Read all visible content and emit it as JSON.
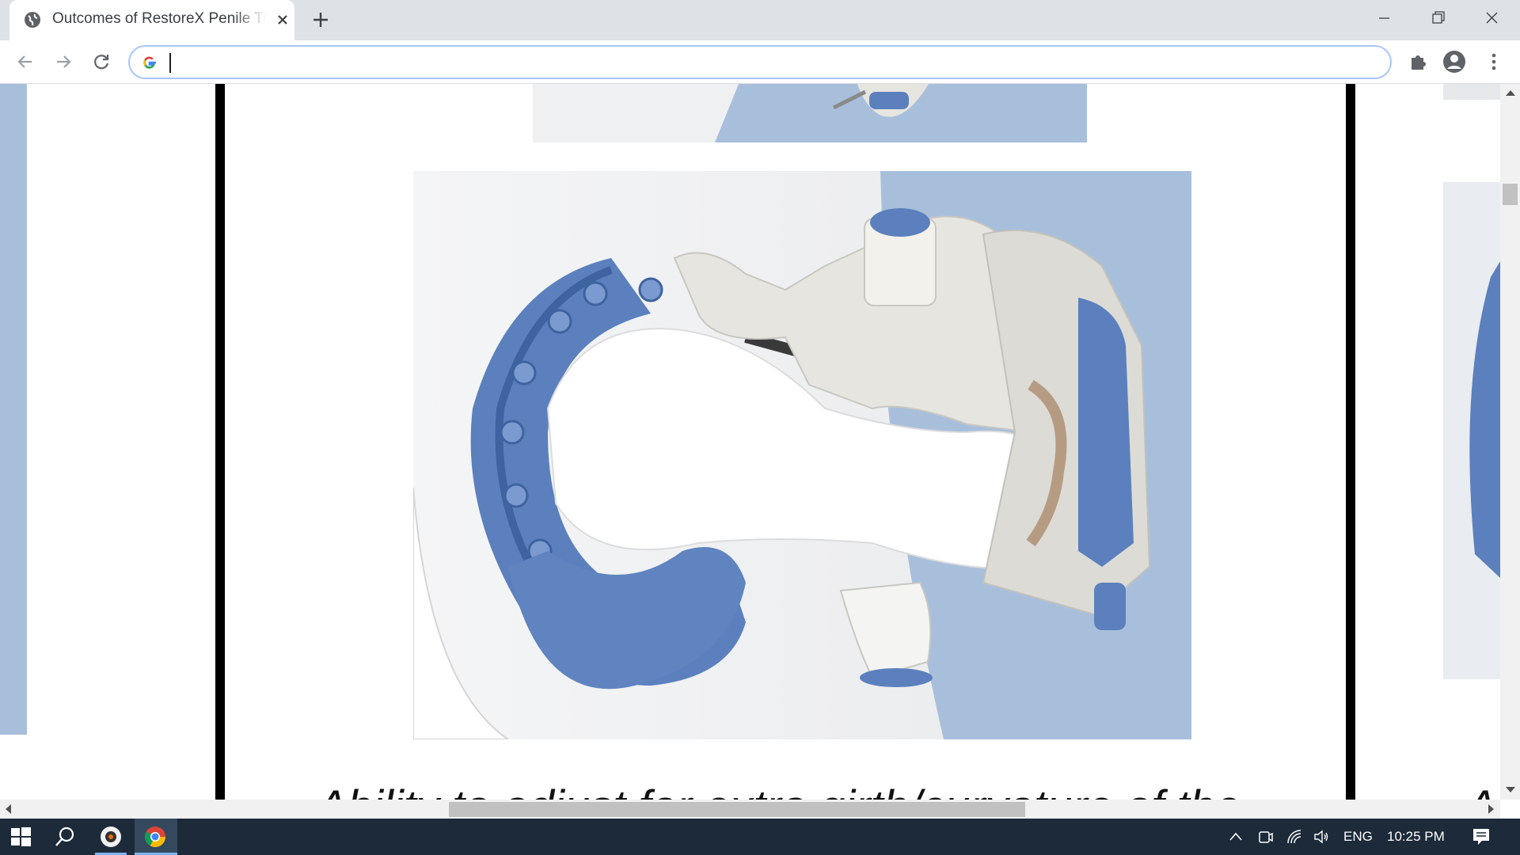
{
  "browser": {
    "tab": {
      "title": "Outcomes of RestoreX Penile Traction Therapy",
      "favicon": "globe-icon",
      "close_icon": "close-icon"
    },
    "new_tab_icon": "plus-icon",
    "window_controls": [
      "minimize-icon",
      "restore-icon",
      "close-icon"
    ],
    "nav": [
      "back-arrow-icon",
      "forward-arrow-icon",
      "reload-icon"
    ],
    "omnibox": {
      "value": "",
      "search_engine_icon": "google-g-icon"
    },
    "toolbar_icons": [
      "extensions-puzzle-icon",
      "profile-avatar-icon",
      "menu-kebab-icon"
    ]
  },
  "page": {
    "main_image": "penile-traction-device-image",
    "bottom_text": "Ability to adjust for extra girth/curvature of the",
    "right_text": "Al",
    "colors": {
      "device_blue": "#5b80bd",
      "background_blue": "#a8bfdc",
      "device_gray": "#e6e5e0"
    }
  },
  "taskbar": {
    "apps": [
      "windows-start-icon",
      "search-icon",
      "media-app-icon",
      "chrome-icon"
    ],
    "tray": {
      "icons": [
        "chevron-up-icon",
        "camera-icon",
        "wifi-icon",
        "volume-icon"
      ],
      "language": "ENG",
      "time": "10:25 PM",
      "notification_icon": "notification-icon"
    }
  }
}
